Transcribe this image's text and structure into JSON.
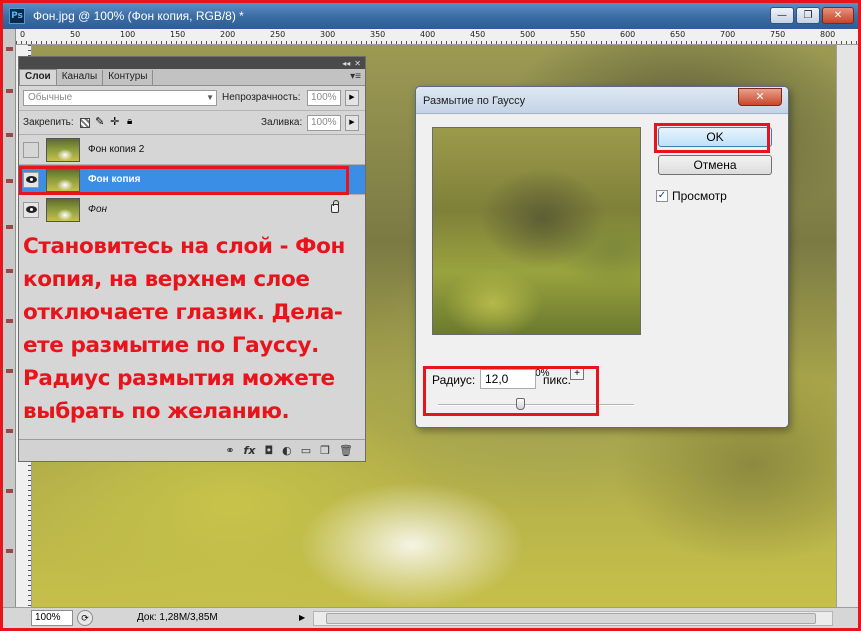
{
  "window": {
    "app_icon": "Ps",
    "title": "Фон.jpg @ 100% (Фон копия, RGB/8) *",
    "controls": [
      "minimize-icon",
      "restore-icon",
      "close-icon"
    ]
  },
  "ruler_top_labels": [
    "0",
    "50",
    "100",
    "150",
    "200",
    "250",
    "300",
    "350",
    "400",
    "450",
    "500",
    "550",
    "600",
    "650",
    "700",
    "750",
    "800"
  ],
  "layers_panel": {
    "tabs": [
      "Слои",
      "Каналы",
      "Контуры"
    ],
    "active_tab": "Слои",
    "blend_mode": "Обычные",
    "opacity_label": "Непрозрачность:",
    "opacity_value": "100%",
    "lock_label": "Закрепить:",
    "fill_label": "Заливка:",
    "fill_value": "100%",
    "layers": [
      {
        "name": "Фон копия 2",
        "visible": false,
        "selected": false,
        "locked": false
      },
      {
        "name": "Фон копия",
        "visible": true,
        "selected": true,
        "locked": false
      },
      {
        "name": "Фон",
        "visible": true,
        "selected": false,
        "locked": true
      }
    ],
    "bottom_icons": [
      "link-icon",
      "fx-icon",
      "mask-icon",
      "adjustment-icon",
      "group-icon",
      "new-layer-icon",
      "trash-icon"
    ],
    "bottom_glyphs": [
      "⚭",
      "fx",
      "◘",
      "◐",
      "▭",
      "❐",
      "🗑"
    ]
  },
  "annotation": {
    "lines": [
      "Становитесь на слой - Фон",
      "копия, на верхнем слое",
      "отключаете глазик. Дела-",
      "ете размытие по Гауссу.",
      "Радиус размытия можете",
      "выбрать по желанию."
    ],
    "color": "#e8141c"
  },
  "dialog": {
    "title": "Размытие по Гауссу",
    "close_glyph": "✕",
    "ok_label": "OK",
    "cancel_label": "Отмена",
    "preview_label": "Просмотр",
    "preview_checked": true,
    "zoom_minus": "−",
    "zoom_plus": "+",
    "zoom_value": "100%",
    "radius_label": "Радиус:",
    "radius_value": "12,0",
    "radius_unit": "пикс.",
    "slider_position": 0.42
  },
  "status": {
    "zoom": "100%",
    "doc_size": "Док: 1,28M/3,85M",
    "arrow": "▶"
  },
  "colors": {
    "highlight_red": "#e8141c",
    "selected_layer": "#3a8ee6"
  }
}
